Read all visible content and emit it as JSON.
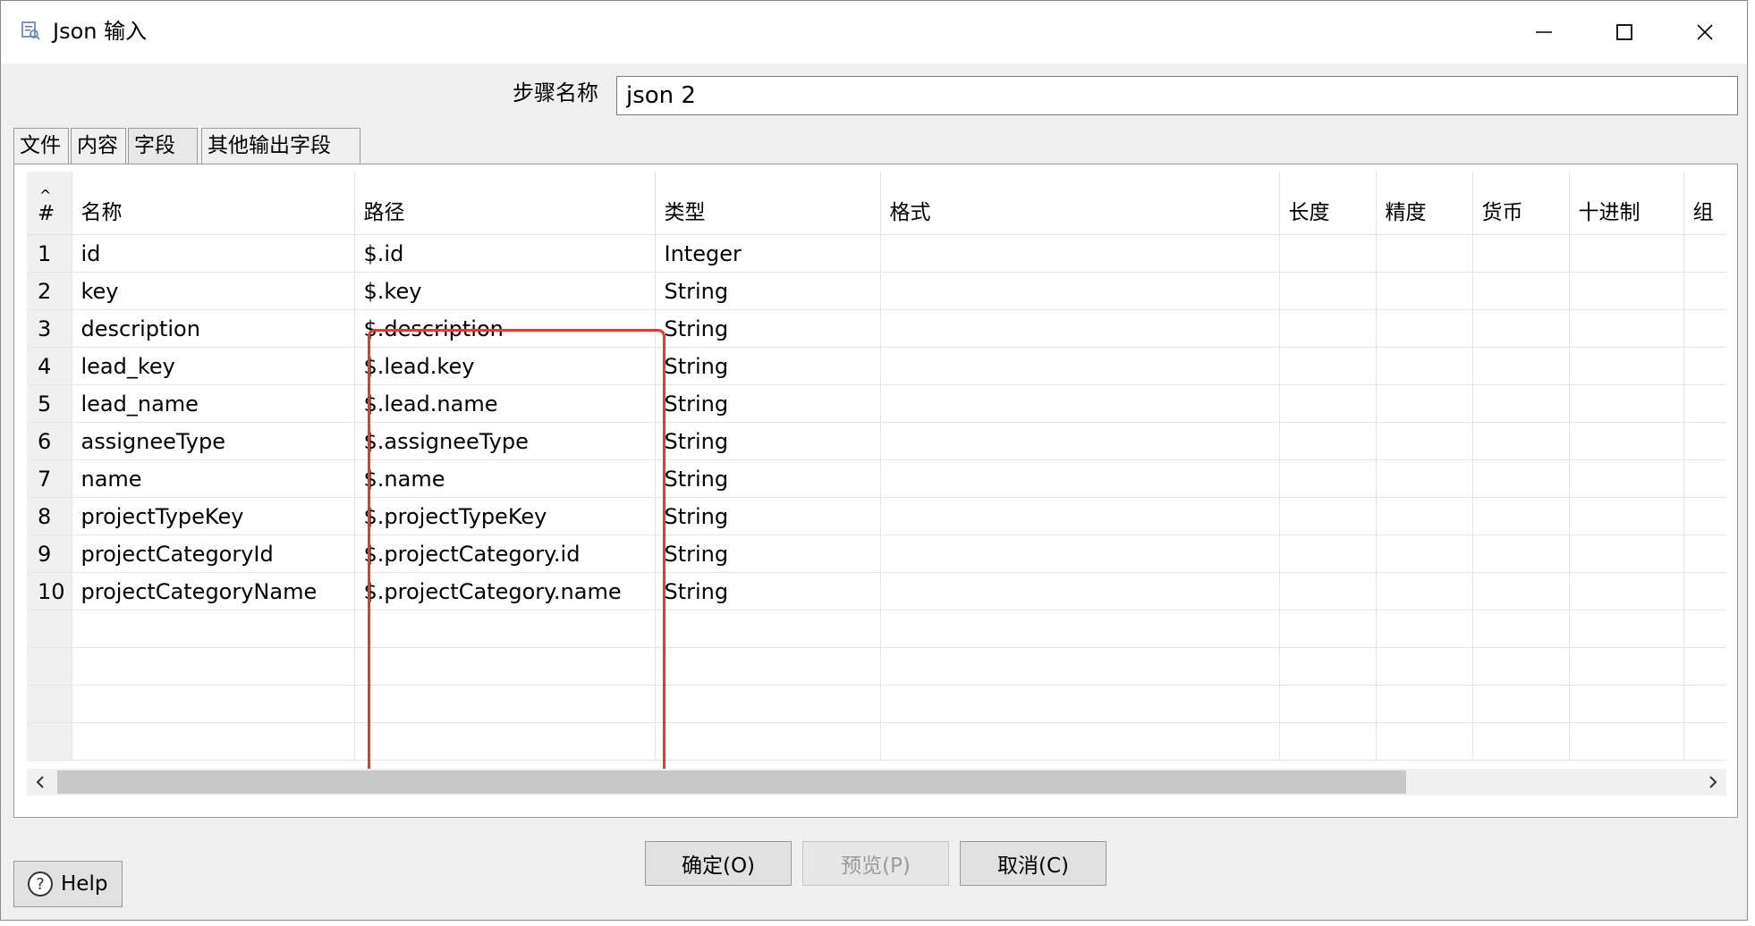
{
  "window": {
    "title": "Json 输入",
    "icon": "json-input-icon"
  },
  "step": {
    "label": "步骤名称",
    "value": "json 2"
  },
  "tabs": [
    {
      "label": "文件"
    },
    {
      "label": "内容"
    },
    {
      "label": "字段"
    },
    {
      "label": "其他输出字段"
    }
  ],
  "table": {
    "sort_glyph": "^",
    "columns": {
      "num": "#",
      "name": "名称",
      "path": "路径",
      "type": "类型",
      "format": "格式",
      "length": "长度",
      "precision": "精度",
      "currency": "货币",
      "decimal": "十进制",
      "group": "组"
    },
    "rows": [
      {
        "num": "1",
        "name": "id",
        "path": "$.id",
        "type": "Integer"
      },
      {
        "num": "2",
        "name": "key",
        "path": "$.key",
        "type": "String"
      },
      {
        "num": "3",
        "name": "description",
        "path": "$.description",
        "type": "String"
      },
      {
        "num": "4",
        "name": "lead_key",
        "path": "$.lead.key",
        "type": "String"
      },
      {
        "num": "5",
        "name": "lead_name",
        "path": "$.lead.name",
        "type": "String"
      },
      {
        "num": "6",
        "name": "assigneeType",
        "path": "$.assigneeType",
        "type": "String"
      },
      {
        "num": "7",
        "name": "name",
        "path": "$.name",
        "type": "String"
      },
      {
        "num": "8",
        "name": "projectTypeKey",
        "path": "$.projectTypeKey",
        "type": "String"
      },
      {
        "num": "9",
        "name": "projectCategoryId",
        "path": "$.projectCategory.id",
        "type": "String"
      },
      {
        "num": "10",
        "name": "projectCategoryName",
        "path": "$.projectCategory.name",
        "type": "String"
      }
    ]
  },
  "buttons": {
    "ok": "确定(O)",
    "preview": "预览(P)",
    "cancel": "取消(C)",
    "help": "Help"
  },
  "colors": {
    "highlight": "#e23b2e",
    "window_bg": "#f0f0f0"
  }
}
